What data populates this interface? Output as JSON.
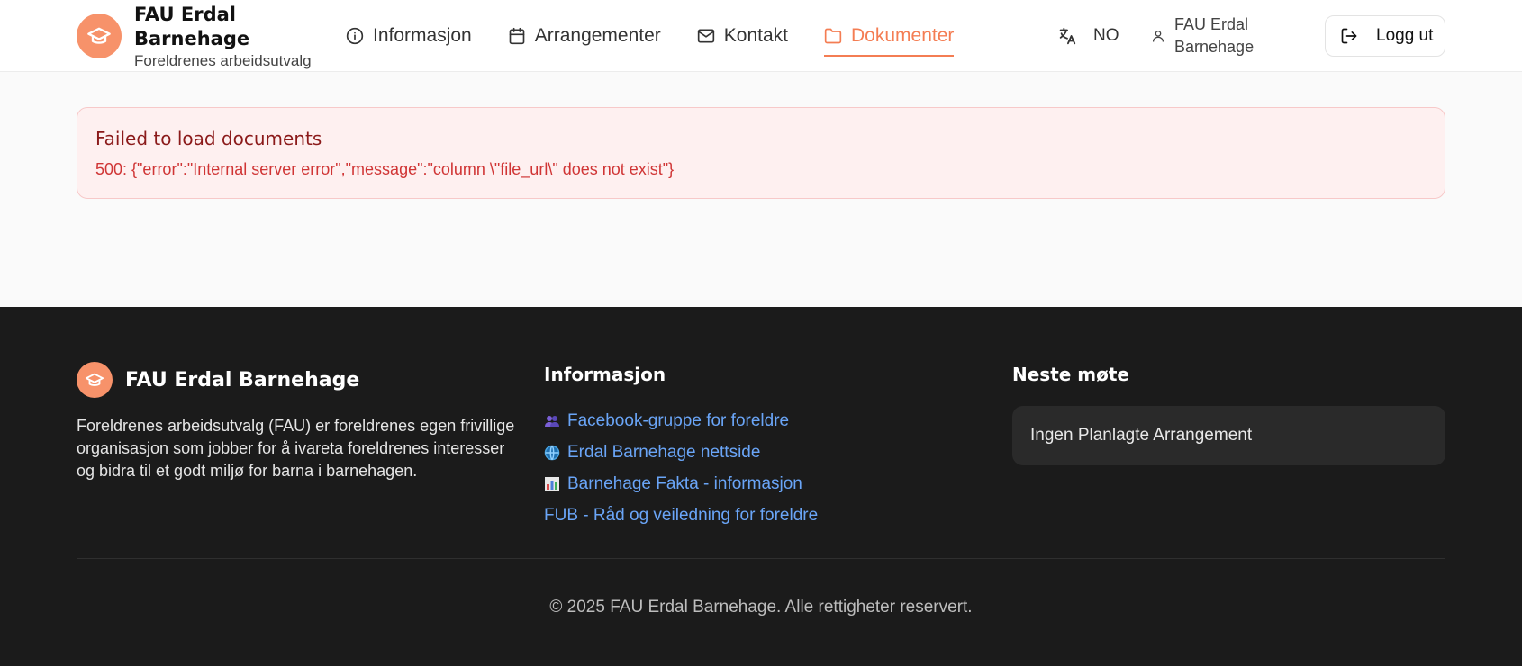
{
  "header": {
    "brand_title": "FAU Erdal Barnehage",
    "brand_subtitle": "Foreldrenes arbeidsutvalg",
    "nav": [
      {
        "label": "Informasjon",
        "icon": "info-icon"
      },
      {
        "label": "Arrangementer",
        "icon": "calendar-icon"
      },
      {
        "label": "Kontakt",
        "icon": "mail-icon"
      },
      {
        "label": "Dokumenter",
        "icon": "folder-icon",
        "active": true
      }
    ],
    "language": "NO",
    "user_name": "FAU Erdal Barnehage",
    "logout_label": "Logg ut"
  },
  "error": {
    "title": "Failed to load documents",
    "message": "500: {\"error\":\"Internal server error\",\"message\":\"column \\\"file_url\\\" does not exist\"}"
  },
  "footer": {
    "brand_title": "FAU Erdal Barnehage",
    "description": "Foreldrenes arbeidsutvalg (FAU) er foreldrenes egen frivillige organisasjon som jobber for å ivareta foreldrenes interesser og bidra til et godt miljø for barna i barnehagen.",
    "info_title": "Informasjon",
    "links": [
      {
        "label": "Facebook-gruppe for foreldre",
        "icon": "people-emoji"
      },
      {
        "label": "Erdal Barnehage nettside",
        "icon": "globe-emoji"
      },
      {
        "label": "Barnehage Fakta - informasjon",
        "icon": "chart-emoji"
      },
      {
        "label": "FUB - Råd og veiledning for foreldre",
        "icon": ""
      }
    ],
    "meeting_title": "Neste møte",
    "meeting_text": "Ingen Planlagte Arrangement",
    "copyright": "© 2025 FAU Erdal Barnehage. Alle rettigheter reservert."
  },
  "colors": {
    "accent": "#f47d53",
    "logo_bg": "#f7926a",
    "link": "#6aa5f7",
    "error_text": "#d03535",
    "footer_bg": "#1b1b1b"
  }
}
